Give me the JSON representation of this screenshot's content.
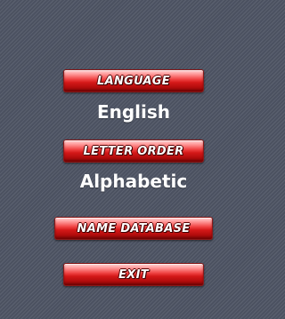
{
  "menu": {
    "language_button": "LANGUAGE",
    "language_value": "English",
    "letter_order_button": "LETTER ORDER",
    "letter_order_value": "Alphabetic",
    "name_database_button": "NAME DATABASE",
    "exit_button": "EXIT"
  },
  "colors": {
    "background": "#515766",
    "button_red": "#d41818",
    "button_highlight": "#ffd6d6",
    "text": "#ffffff"
  }
}
